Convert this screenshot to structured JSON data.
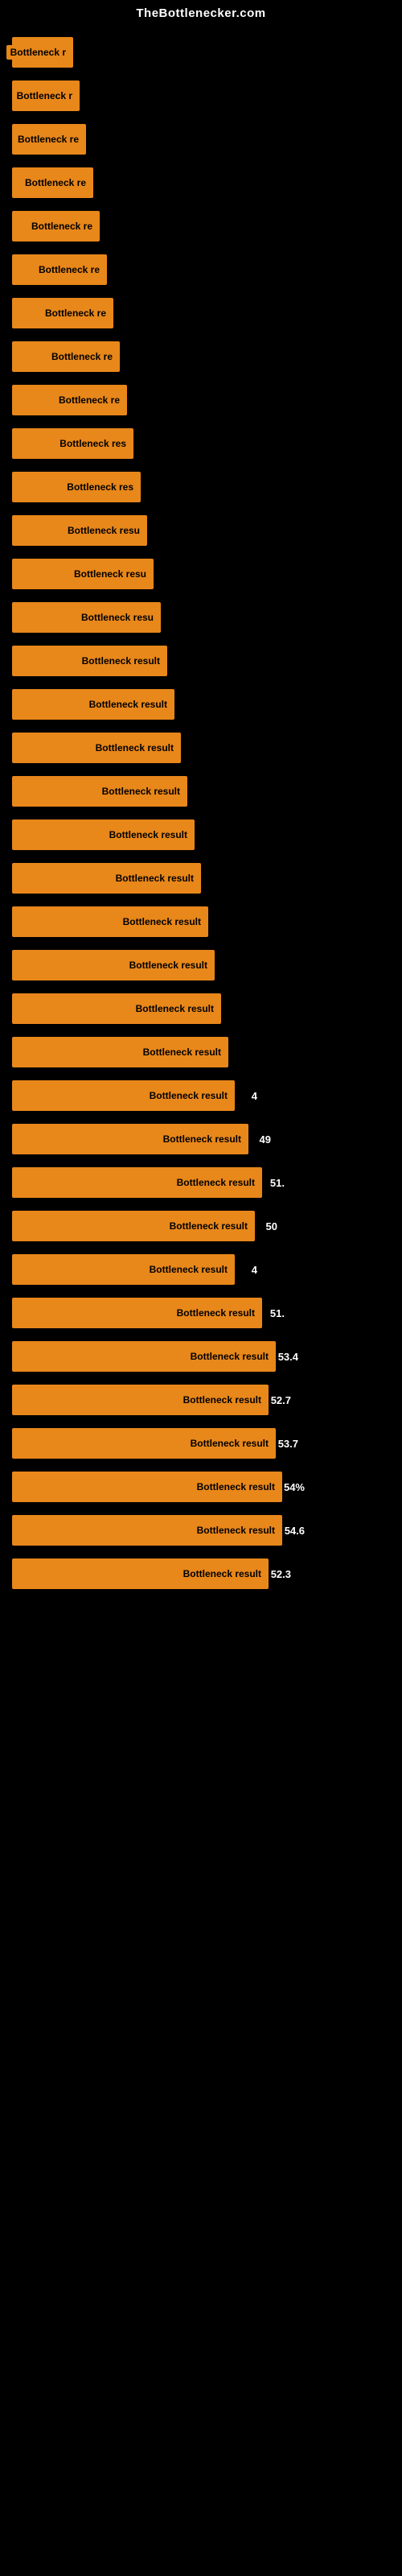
{
  "header": {
    "title": "TheBottlenecker.com"
  },
  "bars": [
    {
      "label": "Bottleneck r",
      "value": null,
      "width": 18
    },
    {
      "label": "Bottleneck r",
      "value": null,
      "width": 20
    },
    {
      "label": "Bottleneck re",
      "value": null,
      "width": 22
    },
    {
      "label": "Bottleneck re",
      "value": null,
      "width": 24
    },
    {
      "label": "Bottleneck re",
      "value": null,
      "width": 26
    },
    {
      "label": "Bottleneck re",
      "value": null,
      "width": 28
    },
    {
      "label": "Bottleneck re",
      "value": null,
      "width": 30
    },
    {
      "label": "Bottleneck re",
      "value": null,
      "width": 32
    },
    {
      "label": "Bottleneck re",
      "value": null,
      "width": 34
    },
    {
      "label": "Bottleneck res",
      "value": null,
      "width": 36
    },
    {
      "label": "Bottleneck res",
      "value": null,
      "width": 38
    },
    {
      "label": "Bottleneck resu",
      "value": null,
      "width": 40
    },
    {
      "label": "Bottleneck resu",
      "value": null,
      "width": 42
    },
    {
      "label": "Bottleneck resu",
      "value": null,
      "width": 44
    },
    {
      "label": "Bottleneck result",
      "value": null,
      "width": 46
    },
    {
      "label": "Bottleneck result",
      "value": null,
      "width": 48
    },
    {
      "label": "Bottleneck result",
      "value": null,
      "width": 50
    },
    {
      "label": "Bottleneck result",
      "value": null,
      "width": 52
    },
    {
      "label": "Bottleneck result",
      "value": null,
      "width": 54
    },
    {
      "label": "Bottleneck result",
      "value": null,
      "width": 56
    },
    {
      "label": "Bottleneck result",
      "value": null,
      "width": 58
    },
    {
      "label": "Bottleneck result",
      "value": null,
      "width": 60
    },
    {
      "label": "Bottleneck result",
      "value": null,
      "width": 62
    },
    {
      "label": "Bottleneck result",
      "value": null,
      "width": 64
    },
    {
      "label": "Bottleneck result",
      "value": "4",
      "width": 66
    },
    {
      "label": "Bottleneck result",
      "value": "49",
      "width": 70
    },
    {
      "label": "Bottleneck result",
      "value": "51.",
      "width": 74
    },
    {
      "label": "Bottleneck result",
      "value": "50",
      "width": 72
    },
    {
      "label": "Bottleneck result",
      "value": "4",
      "width": 66
    },
    {
      "label": "Bottleneck result",
      "value": "51.",
      "width": 74
    },
    {
      "label": "Bottleneck result",
      "value": "53.4",
      "width": 78
    },
    {
      "label": "Bottleneck result",
      "value": "52.7",
      "width": 76
    },
    {
      "label": "Bottleneck result",
      "value": "53.7",
      "width": 78
    },
    {
      "label": "Bottleneck result",
      "value": "54%",
      "width": 80
    },
    {
      "label": "Bottleneck result",
      "value": "54.6",
      "width": 80
    },
    {
      "label": "Bottleneck result",
      "value": "52.3",
      "width": 76
    }
  ],
  "colors": {
    "bar": "#e8871a",
    "background": "#000000",
    "text": "#000000",
    "header": "#ffffff"
  }
}
